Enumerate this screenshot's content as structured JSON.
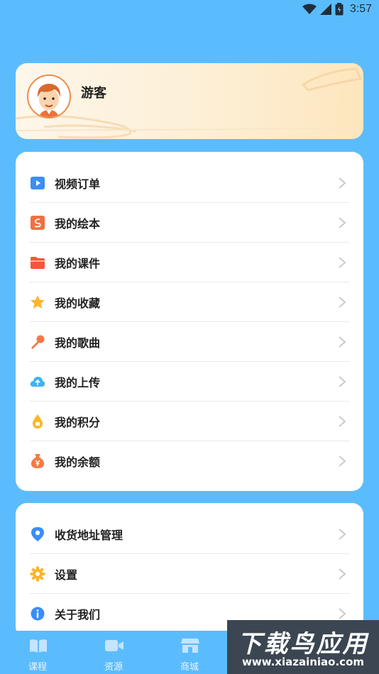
{
  "status_bar": {
    "time": "3:57"
  },
  "profile": {
    "username": "游客"
  },
  "menu_main": [
    {
      "label": "视频订单",
      "icon": "video-order-icon"
    },
    {
      "label": "我的绘本",
      "icon": "picture-book-icon"
    },
    {
      "label": "我的课件",
      "icon": "courseware-folder-icon"
    },
    {
      "label": "我的收藏",
      "icon": "star-icon"
    },
    {
      "label": "我的歌曲",
      "icon": "microphone-icon"
    },
    {
      "label": "我的上传",
      "icon": "cloud-upload-icon"
    },
    {
      "label": "我的积分",
      "icon": "points-drop-icon"
    },
    {
      "label": "我的余额",
      "icon": "money-bag-icon"
    }
  ],
  "menu_settings": [
    {
      "label": "收货地址管理",
      "icon": "location-pin-icon"
    },
    {
      "label": "设置",
      "icon": "gear-icon"
    },
    {
      "label": "关于我们",
      "icon": "info-icon"
    }
  ],
  "tabs": [
    {
      "label": "课程",
      "icon": "book-icon"
    },
    {
      "label": "资源",
      "icon": "video-camera-icon"
    },
    {
      "label": "商城",
      "icon": "store-icon"
    }
  ],
  "watermark": {
    "title": "下载鸟应用",
    "url": "www.xiazainiao.com"
  },
  "colors": {
    "background": "#5bbcfd",
    "card": "#ffffff",
    "profile_gradient_start": "#fdf6ea",
    "profile_gradient_end": "#fde6bd",
    "avatar_border": "#f08a46"
  }
}
